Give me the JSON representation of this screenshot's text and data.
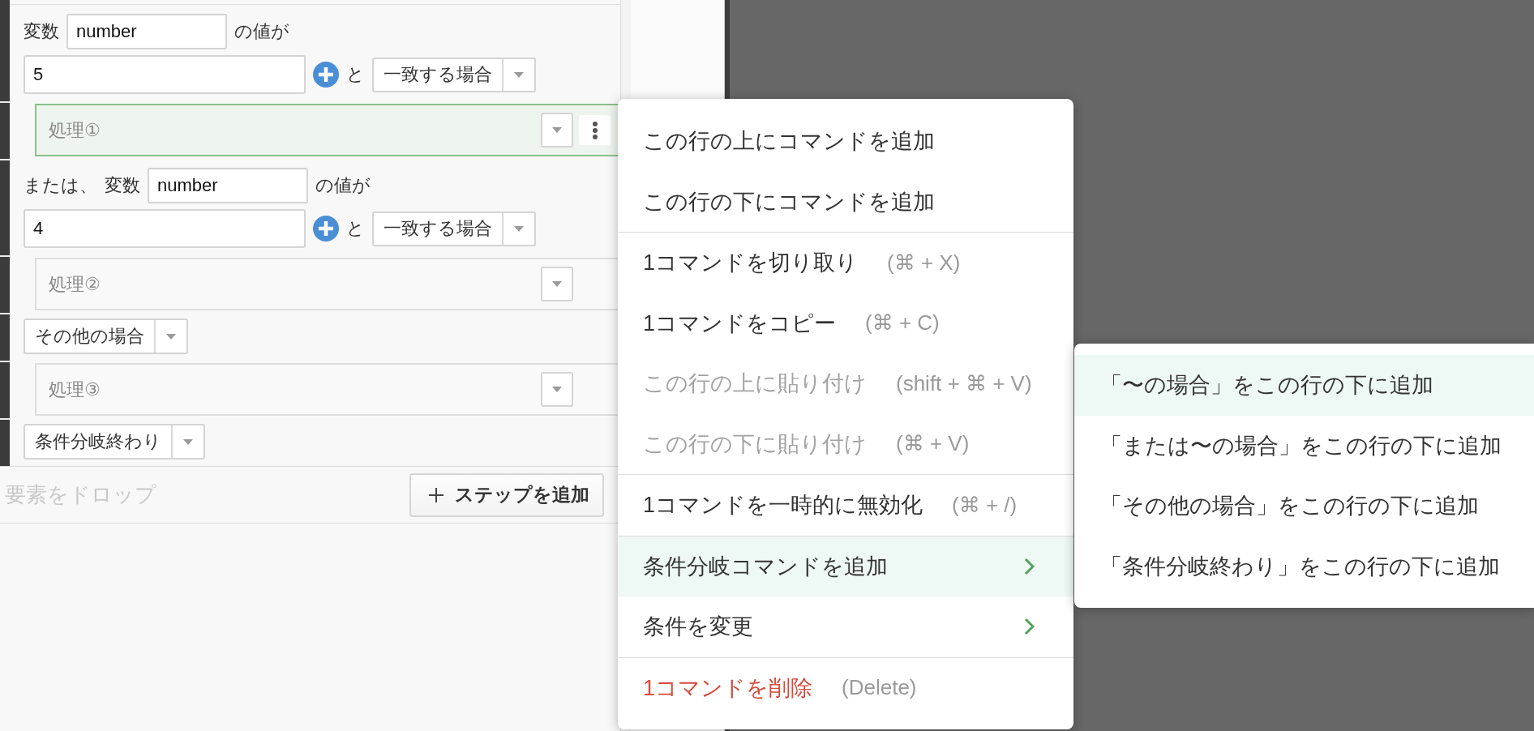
{
  "editor": {
    "steps": [
      {
        "kind": "condition",
        "selected": false,
        "variable_label": "変数",
        "variable": "number",
        "suffix": "の値が",
        "value": "5",
        "connector": "と",
        "operator": "一致する場合"
      },
      {
        "kind": "block",
        "selected": true,
        "label": "処理①"
      },
      {
        "kind": "condition",
        "selected": false,
        "prefix": "または、",
        "variable_label": "変数",
        "variable": "number",
        "suffix": "の値が",
        "value": "4",
        "connector": "と",
        "operator": "一致する場合"
      },
      {
        "kind": "block",
        "selected": false,
        "label": "処理②"
      },
      {
        "kind": "branch",
        "selected": false,
        "value": "その他の場合"
      },
      {
        "kind": "block",
        "selected": false,
        "label": "処理③"
      },
      {
        "kind": "branch",
        "selected": false,
        "value": "条件分岐終わり"
      }
    ],
    "drop_zone": {
      "hint": "要素をドロップ"
    },
    "add_step_button": {
      "label": "ステップを追加"
    }
  },
  "context_menu": {
    "groups": [
      {
        "items": [
          {
            "label": "この行の上にコマンドを追加",
            "kind": "command",
            "disabled": false,
            "selected": false
          },
          {
            "label": "この行の下にコマンドを追加",
            "kind": "command",
            "disabled": false,
            "selected": false
          }
        ]
      },
      {
        "items": [
          {
            "label": "1コマンドを切り取り",
            "shortcut": "(⌘ + X)",
            "kind": "command",
            "disabled": false,
            "selected": false
          },
          {
            "label": "1コマンドをコピー",
            "shortcut": "(⌘ + C)",
            "kind": "command",
            "disabled": false,
            "selected": false
          },
          {
            "label": "この行の上に貼り付け",
            "shortcut": "(shift + ⌘ + V)",
            "kind": "command",
            "disabled": true,
            "selected": false
          },
          {
            "label": "この行の下に貼り付け",
            "shortcut": "(⌘ + V)",
            "kind": "command",
            "disabled": true,
            "selected": false
          }
        ]
      },
      {
        "items": [
          {
            "label": "1コマンドを一時的に無効化",
            "shortcut": "(⌘ + /)",
            "kind": "command",
            "disabled": false,
            "selected": false
          }
        ]
      },
      {
        "items": [
          {
            "label": "条件分岐コマンドを追加",
            "kind": "submenu",
            "disabled": false,
            "selected": true
          },
          {
            "label": "条件を変更",
            "kind": "submenu",
            "disabled": false,
            "selected": false
          }
        ]
      },
      {
        "items": [
          {
            "label": "1コマンドを削除",
            "shortcut": "(Delete)",
            "kind": "danger",
            "disabled": false,
            "selected": false
          }
        ]
      }
    ],
    "submenu": {
      "items": [
        {
          "label": "「〜の場合」をこの行の下に追加",
          "selected": true
        },
        {
          "label": "「または〜の場合」をこの行の下に追加",
          "selected": false
        },
        {
          "label": "「その他の場合」をこの行の下に追加",
          "selected": false
        },
        {
          "label": "「条件分岐終わり」をこの行の下に追加",
          "selected": false
        }
      ]
    }
  }
}
